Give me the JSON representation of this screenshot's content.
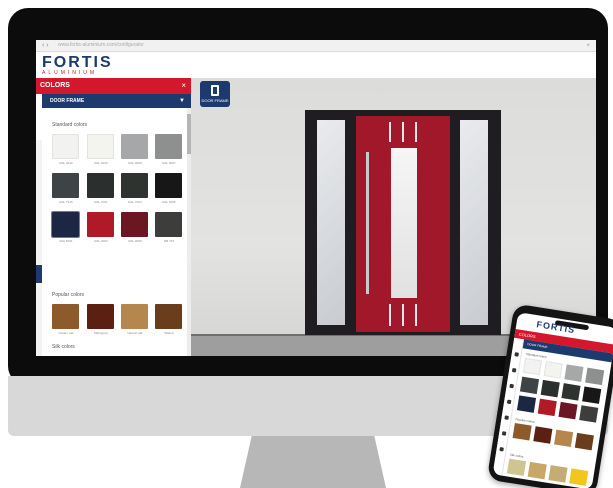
{
  "browser": {
    "url": "www.fortis-aluminium.com/configurator",
    "nav_glyph": "‹ ›",
    "close_glyph": "×"
  },
  "brand": {
    "name": "FORTIS",
    "tagline": "ALUMINIUM",
    "primary_color": "#1d3a6e",
    "accent_color": "#d3182e"
  },
  "panel": {
    "title": "COLORS",
    "close_glyph": "×",
    "selector_label": "DOOR FRAME",
    "selector_chevron": "▼",
    "sections": [
      {
        "title": "Standard colors",
        "swatches": [
          {
            "label": "RAL 9016",
            "color": "#f2f2f0"
          },
          {
            "label": "RAL 9010",
            "color": "#f4f4ef"
          },
          {
            "label": "RAL 9006",
            "color": "#a5a7a9"
          },
          {
            "label": "RAL 9007",
            "color": "#8e8f8f"
          },
          {
            "label": "RAL 7016",
            "color": "#3e4346"
          },
          {
            "label": "RAL 7021",
            "color": "#2b302f"
          },
          {
            "label": "RAL 7024",
            "color": "#2f3330"
          },
          {
            "label": "RAL 9005",
            "color": "#171717"
          },
          {
            "label": "RAL 5011",
            "color": "#1c2744",
            "selected": true
          },
          {
            "label": "RAL 3003",
            "color": "#b01a27"
          },
          {
            "label": "RAL 3005",
            "color": "#6b1622"
          },
          {
            "label": "DB 703",
            "color": "#3d3d3b"
          }
        ]
      },
      {
        "title": "Popular colors",
        "swatches": [
          {
            "label": "Golden oak",
            "color": "#8c5a2b"
          },
          {
            "label": "Mahogany",
            "color": "#5b2012"
          },
          {
            "label": "Natural oak",
            "color": "#b5864e"
          },
          {
            "label": "Walnut",
            "color": "#6a3e1c"
          }
        ]
      },
      {
        "title": "Silk colors",
        "swatches": [
          {
            "label": "",
            "color": "#cfc593"
          },
          {
            "label": "",
            "color": "#c9a768"
          },
          {
            "label": "",
            "color": "#c4ac72"
          },
          {
            "label": "",
            "color": "#f0c61f"
          }
        ]
      }
    ]
  },
  "frame_button": {
    "label": "DOOR FRAME",
    "icon": "door-icon"
  },
  "door": {
    "leaf_color": "#a0182a",
    "frame_color": "#1f1d22"
  },
  "phone": {
    "logo": "FORTIS",
    "title": "COLORS",
    "selector_label": "DOOR FRAME",
    "sections": [
      "Standard colors",
      "Popular colors",
      "Silk colors"
    ]
  }
}
